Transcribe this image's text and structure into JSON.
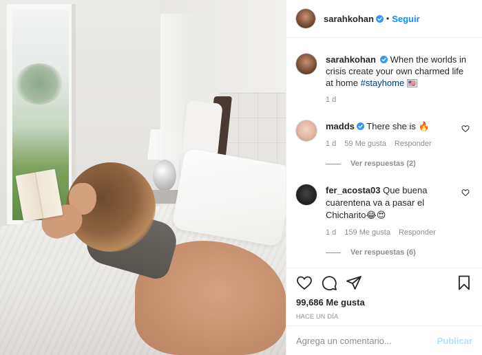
{
  "post": {
    "image_alt": "Photo",
    "header": {
      "username": "sarahkohan",
      "separator": "•",
      "follow_label": "Seguir",
      "verified_icon": "verified-badge-icon"
    },
    "caption": {
      "username": "sarahkohan",
      "text": "When the worlds in crisis create your own charmed life at home",
      "hashtag": "#stayhome",
      "flag": "🇺🇸",
      "time": "1 d"
    },
    "comments": [
      {
        "username": "madds",
        "verified": true,
        "text": "There she is 🔥",
        "time": "1 d",
        "likes": "59 Me gusta",
        "reply_label": "Responder",
        "view_replies": "Ver respuestas (2)"
      },
      {
        "username": "fer_acosta03",
        "verified": false,
        "text": "Que buena cuarentena va a pasar el Chicharito😂😍",
        "time": "1 d",
        "likes": "159 Me gusta",
        "reply_label": "Responder",
        "view_replies": "Ver respuestas (6)"
      }
    ],
    "actions": {
      "like_icon": "heart-icon",
      "comment_icon": "comment-icon",
      "share_icon": "send-icon",
      "save_icon": "bookmark-icon"
    },
    "likes_count": "99,686 Me gusta",
    "posted_ago": "HACE UN DÍA",
    "add_comment": {
      "placeholder": "Agrega un comentario...",
      "post_label": "Publicar"
    },
    "colors": {
      "link_blue": "#0095f6",
      "hashtag_blue": "#00376b",
      "muted_text": "#8e8e8e",
      "post_disabled": "#b2dffc"
    }
  }
}
